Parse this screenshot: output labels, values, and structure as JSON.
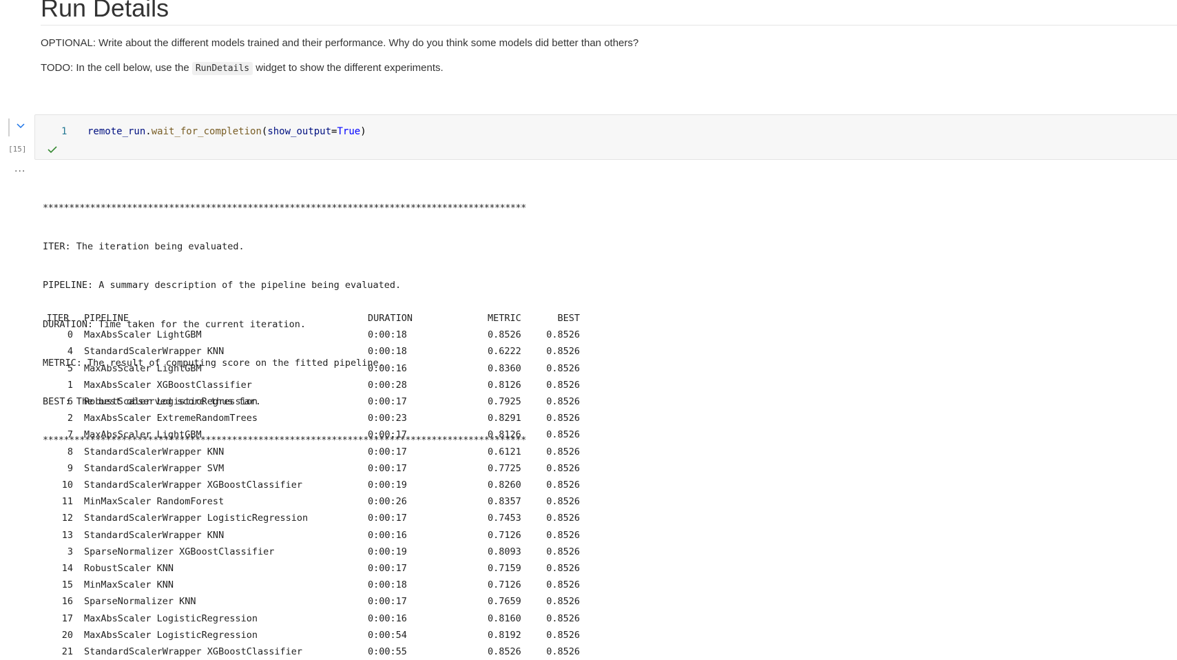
{
  "markdown": {
    "heading": "Run Details",
    "optional_text": "OPTIONAL: Write about the different models trained and their performance. Why do you think some models did better than others?",
    "todo_prefix": "TODO: In the cell below, use the",
    "todo_code": "RunDetails",
    "todo_suffix": "widget to show the different experiments."
  },
  "cell": {
    "execution_count": "[15]",
    "line_number": "1",
    "code": {
      "var": "remote_run",
      "dot": ".",
      "fn": "wait_for_completion",
      "open": "(",
      "param": "show_output",
      "eq": "=",
      "kw": "True",
      "close": ")"
    },
    "status_icon": "check-icon",
    "collapse_icon": "chevron-down-icon",
    "output_menu": "..."
  },
  "output": {
    "stars": "********************************************************************************************",
    "legend": [
      "ITER: The iteration being evaluated.",
      "PIPELINE: A summary description of the pipeline being evaluated.",
      "DURATION: Time taken for the current iteration.",
      "METRIC: The result of computing score on the fitted pipeline.",
      "BEST: The best observed score thus far."
    ],
    "table": {
      "headers": [
        "ITER",
        "PIPELINE",
        "DURATION",
        "METRIC",
        "BEST"
      ],
      "rows": [
        [
          "0",
          "MaxAbsScaler LightGBM",
          "0:00:18",
          "0.8526",
          "0.8526"
        ],
        [
          "4",
          "StandardScalerWrapper KNN",
          "0:00:18",
          "0.6222",
          "0.8526"
        ],
        [
          "5",
          "MaxAbsScaler LightGBM",
          "0:00:16",
          "0.8360",
          "0.8526"
        ],
        [
          "1",
          "MaxAbsScaler XGBoostClassifier",
          "0:00:28",
          "0.8126",
          "0.8526"
        ],
        [
          "6",
          "RobustScaler LogisticRegression",
          "0:00:17",
          "0.7925",
          "0.8526"
        ],
        [
          "2",
          "MaxAbsScaler ExtremeRandomTrees",
          "0:00:23",
          "0.8291",
          "0.8526"
        ],
        [
          "7",
          "MaxAbsScaler LightGBM",
          "0:00:17",
          "0.8126",
          "0.8526"
        ],
        [
          "8",
          "StandardScalerWrapper KNN",
          "0:00:17",
          "0.6121",
          "0.8526"
        ],
        [
          "9",
          "StandardScalerWrapper SVM",
          "0:00:17",
          "0.7725",
          "0.8526"
        ],
        [
          "10",
          "StandardScalerWrapper XGBoostClassifier",
          "0:00:19",
          "0.8260",
          "0.8526"
        ],
        [
          "11",
          "MinMaxScaler RandomForest",
          "0:00:26",
          "0.8357",
          "0.8526"
        ],
        [
          "12",
          "StandardScalerWrapper LogisticRegression",
          "0:00:17",
          "0.7453",
          "0.8526"
        ],
        [
          "13",
          "StandardScalerWrapper KNN",
          "0:00:16",
          "0.7126",
          "0.8526"
        ],
        [
          "3",
          "SparseNormalizer XGBoostClassifier",
          "0:00:19",
          "0.8093",
          "0.8526"
        ],
        [
          "14",
          "RobustScaler KNN",
          "0:00:17",
          "0.7159",
          "0.8526"
        ],
        [
          "15",
          "MinMaxScaler KNN",
          "0:00:18",
          "0.7126",
          "0.8526"
        ],
        [
          "16",
          "SparseNormalizer KNN",
          "0:00:17",
          "0.7659",
          "0.8526"
        ],
        [
          "17",
          "MaxAbsScaler LogisticRegression",
          "0:00:16",
          "0.8160",
          "0.8526"
        ],
        [
          "20",
          "MaxAbsScaler LogisticRegression",
          "0:00:54",
          "0.8192",
          "0.8526"
        ],
        [
          "21",
          "StandardScalerWrapper XGBoostClassifier",
          "0:00:55",
          "0.8526",
          "0.8526"
        ]
      ]
    }
  }
}
